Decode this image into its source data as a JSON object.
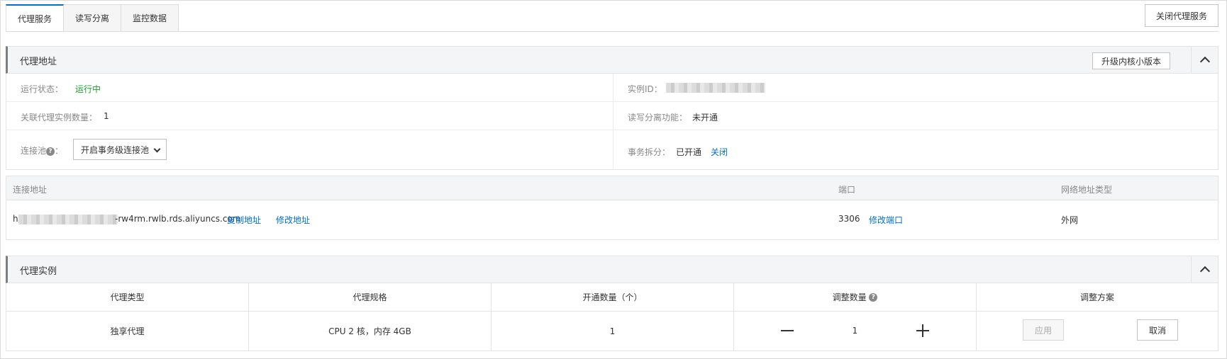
{
  "tabs": [
    {
      "label": "代理服务",
      "active": true
    },
    {
      "label": "读写分离",
      "active": false
    },
    {
      "label": "监控数据",
      "active": false
    }
  ],
  "close_proxy_button": "关闭代理服务",
  "proxy_address": {
    "title": "代理地址",
    "upgrade_button": "升级内核小版本",
    "run_status_label": "运行状态：",
    "run_status_value": "运行中",
    "instance_id_label": "实例ID：",
    "linked_count_label": "关联代理实例数量：",
    "linked_count_value": "1",
    "rw_split_label": "读写分离功能：",
    "rw_split_value": "未开通",
    "pool_label": "连接池",
    "pool_selected": "开启事务级连接池",
    "tx_split_label": "事务拆分：",
    "tx_split_value": "已开通",
    "tx_split_action": "关闭"
  },
  "address_table": {
    "headers": [
      "连接地址",
      "端口",
      "网络地址类型"
    ],
    "row": {
      "address_prefix": "h",
      "address_suffix": "-rw4rm.rwlb.rds.aliyuncs.com",
      "copy_link": "复制地址",
      "modify_address_link": "修改地址",
      "port": "3306",
      "modify_port_link": "修改端口",
      "net_type": "外网"
    }
  },
  "proxy_instance": {
    "title": "代理实例",
    "headers": [
      "代理类型",
      "代理规格",
      "开通数量（个）",
      "调整数量",
      "调整方案"
    ],
    "row": {
      "type": "独享代理",
      "spec": "CPU 2 核，内存 4GB",
      "count": "1",
      "adjust_count": "1",
      "apply_button": "应用",
      "cancel_button": "取消"
    }
  },
  "colors": {
    "accent": "#0070cc",
    "status_green": "#1e9e2b"
  }
}
